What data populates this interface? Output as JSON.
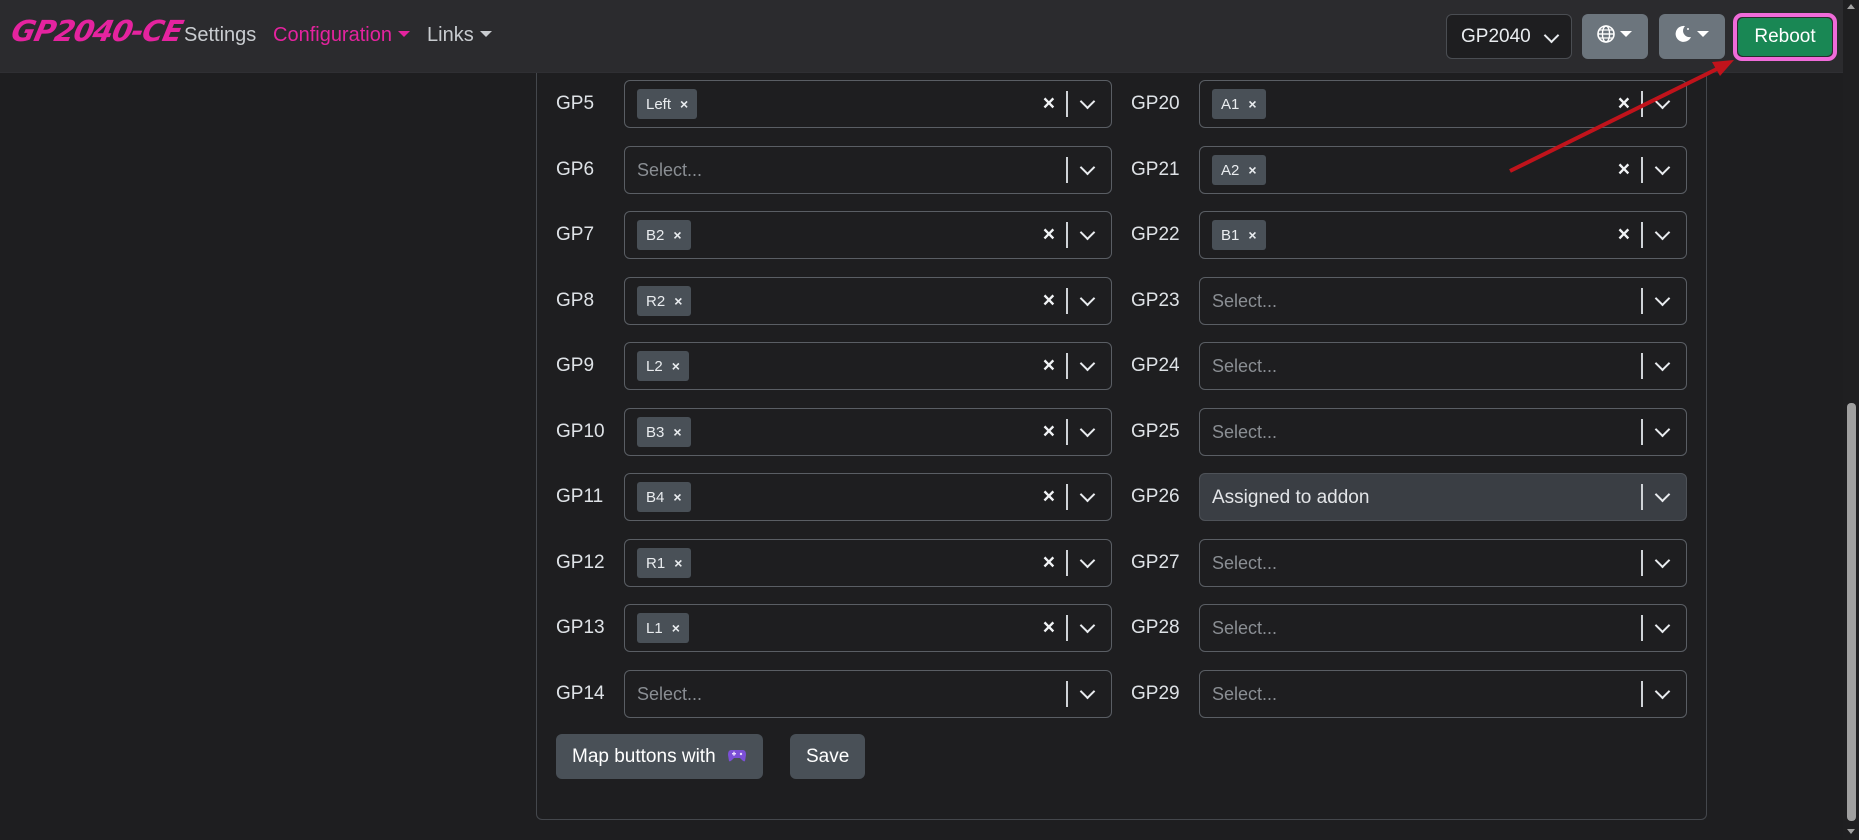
{
  "navbar": {
    "brand": "GP2040-CE",
    "links": [
      "Settings",
      "Configuration",
      "Links"
    ],
    "active_link": "Configuration",
    "board_select": "GP2040",
    "language_icon": "globe-icon",
    "theme_icon": "moon-icon",
    "reboot_label": "Reboot"
  },
  "pins_left": [
    {
      "label": "GP5",
      "value": "Left"
    },
    {
      "label": "GP6",
      "value": ""
    },
    {
      "label": "GP7",
      "value": "B2"
    },
    {
      "label": "GP8",
      "value": "R2"
    },
    {
      "label": "GP9",
      "value": "L2"
    },
    {
      "label": "GP10",
      "value": "B3"
    },
    {
      "label": "GP11",
      "value": "B4"
    },
    {
      "label": "GP12",
      "value": "R1"
    },
    {
      "label": "GP13",
      "value": "L1"
    },
    {
      "label": "GP14",
      "value": ""
    }
  ],
  "pins_right": [
    {
      "label": "GP20",
      "value": "A1"
    },
    {
      "label": "GP21",
      "value": "A2"
    },
    {
      "label": "GP22",
      "value": "B1"
    },
    {
      "label": "GP23",
      "value": ""
    },
    {
      "label": "GP24",
      "value": ""
    },
    {
      "label": "GP25",
      "value": ""
    },
    {
      "label": "GP26",
      "value": "",
      "disabled_text": "Assigned to addon"
    },
    {
      "label": "GP27",
      "value": ""
    },
    {
      "label": "GP28",
      "value": ""
    },
    {
      "label": "GP29",
      "value": ""
    }
  ],
  "select_placeholder": "Select...",
  "actions": {
    "map_buttons_label": "Map buttons with",
    "map_buttons_icon": "gamepad-icon",
    "save_label": "Save"
  },
  "colors": {
    "brand": "#e5239f",
    "reboot": "#198754",
    "highlight": "#ef6bd9",
    "arrow": "#c0131b"
  }
}
